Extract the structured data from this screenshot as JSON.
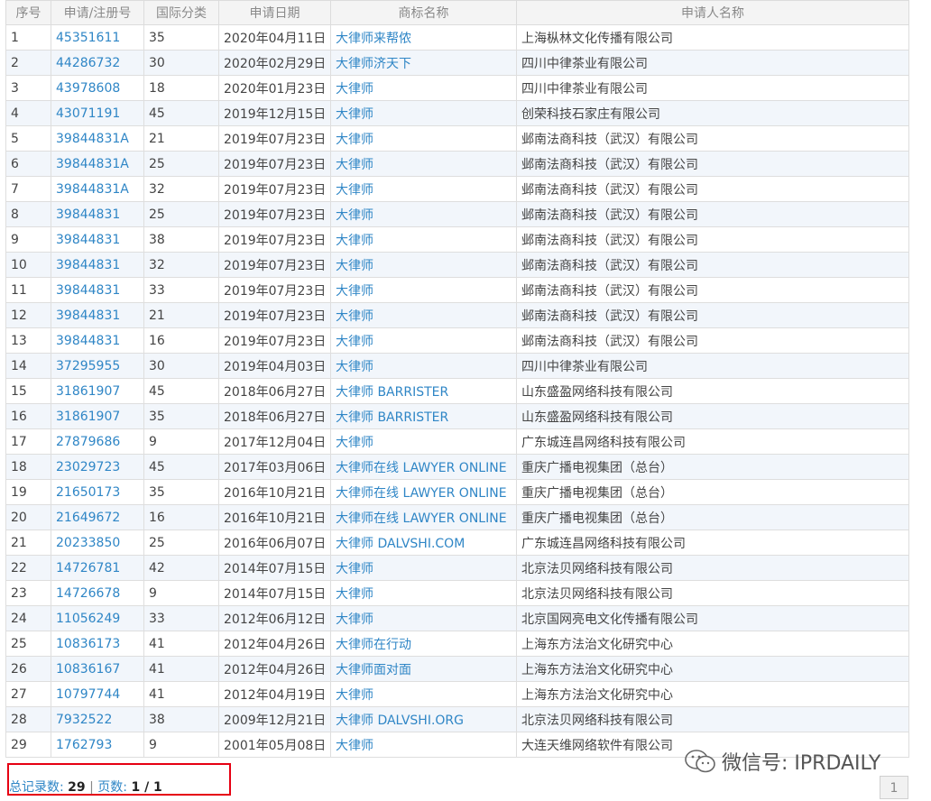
{
  "columns": [
    "序号",
    "申请/注册号",
    "国际分类",
    "申请日期",
    "商标名称",
    "申请人名称"
  ],
  "rows": [
    [
      "1",
      "45351611",
      "35",
      "2020年04月11日",
      "大律师来帮侬",
      "上海枞林文化传播有限公司"
    ],
    [
      "2",
      "44286732",
      "30",
      "2020年02月29日",
      "大律师济天下",
      "四川中律茶业有限公司"
    ],
    [
      "3",
      "43978608",
      "18",
      "2020年01月23日",
      "大律师",
      "四川中律茶业有限公司"
    ],
    [
      "4",
      "43071191",
      "45",
      "2019年12月15日",
      "大律师",
      "创荣科技石家庄有限公司"
    ],
    [
      "5",
      "39844831A",
      "21",
      "2019年07月23日",
      "大律师",
      "邺南法商科技（武汉）有限公司"
    ],
    [
      "6",
      "39844831A",
      "25",
      "2019年07月23日",
      "大律师",
      "邺南法商科技（武汉）有限公司"
    ],
    [
      "7",
      "39844831A",
      "32",
      "2019年07月23日",
      "大律师",
      "邺南法商科技（武汉）有限公司"
    ],
    [
      "8",
      "39844831",
      "25",
      "2019年07月23日",
      "大律师",
      "邺南法商科技（武汉）有限公司"
    ],
    [
      "9",
      "39844831",
      "38",
      "2019年07月23日",
      "大律师",
      "邺南法商科技（武汉）有限公司"
    ],
    [
      "10",
      "39844831",
      "32",
      "2019年07月23日",
      "大律师",
      "邺南法商科技（武汉）有限公司"
    ],
    [
      "11",
      "39844831",
      "33",
      "2019年07月23日",
      "大律师",
      "邺南法商科技（武汉）有限公司"
    ],
    [
      "12",
      "39844831",
      "21",
      "2019年07月23日",
      "大律师",
      "邺南法商科技（武汉）有限公司"
    ],
    [
      "13",
      "39844831",
      "16",
      "2019年07月23日",
      "大律师",
      "邺南法商科技（武汉）有限公司"
    ],
    [
      "14",
      "37295955",
      "30",
      "2019年04月03日",
      "大律师",
      "四川中律茶业有限公司"
    ],
    [
      "15",
      "31861907",
      "45",
      "2018年06月27日",
      "大律师 BARRISTER",
      "山东盛盈网络科技有限公司"
    ],
    [
      "16",
      "31861907",
      "35",
      "2018年06月27日",
      "大律师 BARRISTER",
      "山东盛盈网络科技有限公司"
    ],
    [
      "17",
      "27879686",
      "9",
      "2017年12月04日",
      "大律师",
      "广东城连昌网络科技有限公司"
    ],
    [
      "18",
      "23029723",
      "45",
      "2017年03月06日",
      "大律师在线 LAWYER ONLINE",
      "重庆广播电视集团（总台）"
    ],
    [
      "19",
      "21650173",
      "35",
      "2016年10月21日",
      "大律师在线 LAWYER ONLINE",
      "重庆广播电视集团（总台）"
    ],
    [
      "20",
      "21649672",
      "16",
      "2016年10月21日",
      "大律师在线 LAWYER ONLINE",
      "重庆广播电视集团（总台）"
    ],
    [
      "21",
      "20233850",
      "25",
      "2016年06月07日",
      "大律师 DALVSHI.COM",
      "广东城连昌网络科技有限公司"
    ],
    [
      "22",
      "14726781",
      "42",
      "2014年07月15日",
      "大律师",
      "北京法贝网络科技有限公司"
    ],
    [
      "23",
      "14726678",
      "9",
      "2014年07月15日",
      "大律师",
      "北京法贝网络科技有限公司"
    ],
    [
      "24",
      "11056249",
      "33",
      "2012年06月12日",
      "大律师",
      "北京国网亮电文化传播有限公司"
    ],
    [
      "25",
      "10836173",
      "41",
      "2012年04月26日",
      "大律师在行动",
      "上海东方法治文化研究中心"
    ],
    [
      "26",
      "10836167",
      "41",
      "2012年04月26日",
      "大律师面对面",
      "上海东方法治文化研究中心"
    ],
    [
      "27",
      "10797744",
      "41",
      "2012年04月19日",
      "大律师",
      "上海东方法治文化研究中心"
    ],
    [
      "28",
      "7932522",
      "38",
      "2009年12月21日",
      "大律师 DALVSHI.ORG",
      "北京法贝网络科技有限公司"
    ],
    [
      "29",
      "1762793",
      "9",
      "2001年05月08日",
      "大律师",
      "大连天维网络软件有限公司"
    ]
  ],
  "footer": {
    "total_label": "总记录数:",
    "total_value": "29",
    "separator": "|",
    "pages_label": "页数:",
    "pages_value": "1 / 1"
  },
  "watermark": {
    "text": "微信号: IPRDAILY"
  },
  "pager": {
    "current": "1"
  },
  "colors": {
    "link": "#2f86c6",
    "highlight_border": "#e60012",
    "stripe": "#f2f6fb"
  }
}
